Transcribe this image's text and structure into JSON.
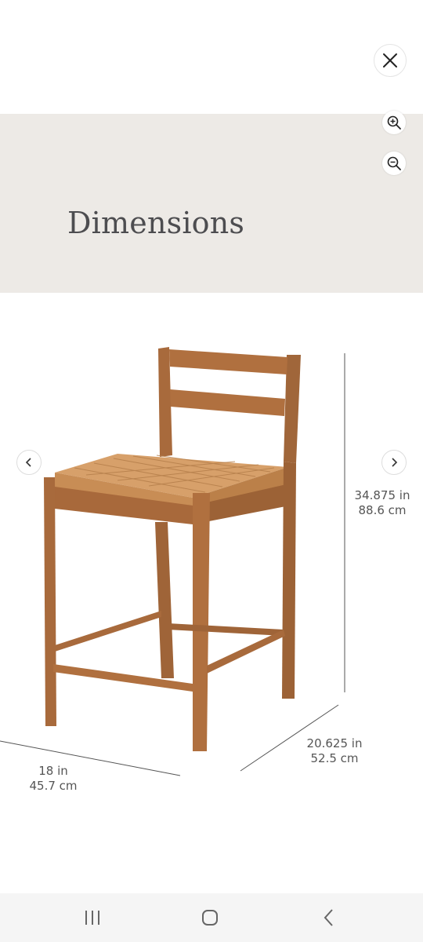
{
  "viewer": {
    "close_icon": "close-icon",
    "zoom_in_icon": "zoom-in-icon",
    "zoom_out_icon": "zoom-out-icon",
    "prev_icon": "chevron-left-icon",
    "next_icon": "chevron-right-icon"
  },
  "banner": {
    "title": "Dimensions",
    "background": "#edeae6"
  },
  "dimensions": {
    "height_in": "34.875 in",
    "height_cm": "88.6 cm",
    "depth_in": "20.625 in",
    "depth_cm": "52.5 cm",
    "width_in": "18 in",
    "width_cm": "45.7 cm"
  },
  "android_nav": {
    "recents_icon": "recents-icon",
    "home_icon": "home-icon",
    "back_icon": "back-icon"
  }
}
